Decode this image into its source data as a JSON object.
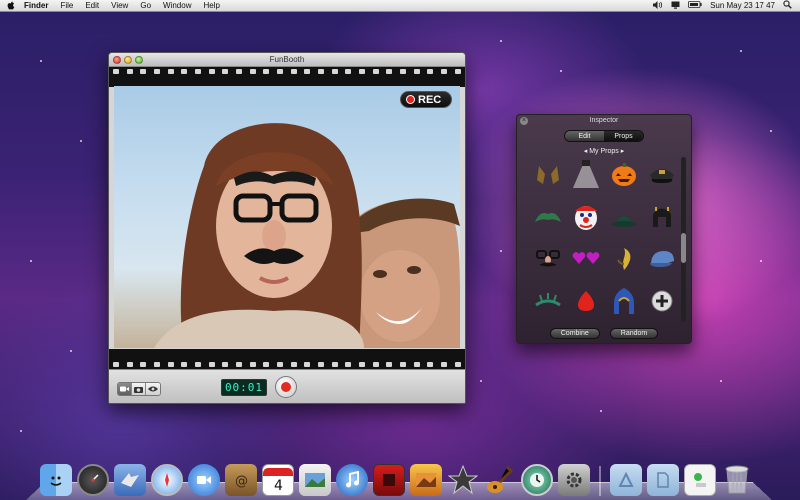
{
  "menubar": {
    "app": "Finder",
    "items": [
      "File",
      "Edit",
      "View",
      "Go",
      "Window",
      "Help"
    ],
    "clock": "Sun May 23  17 47"
  },
  "funbooth": {
    "title": "FunBooth",
    "rec_label": "REC",
    "counter": "00:01",
    "mode_buttons": [
      "video-mode-icon",
      "photo-mode-icon",
      "eye-icon"
    ]
  },
  "inspector": {
    "title": "Inspector",
    "tabs": [
      "Edit",
      "Props"
    ],
    "selected_tab": "Props",
    "section_label": "◂ My Props ▸",
    "props": [
      "cowbell-horns",
      "spotlight",
      "pumpkin-head",
      "police-cap",
      "green-hair",
      "clown-face",
      "green-witch-hat",
      "black-helmet",
      "glasses-mustache",
      "purple-hearts",
      "gold-horn",
      "blue-cap",
      "green-antenna",
      "red-nose",
      "blue-hood",
      "add-prop"
    ],
    "buttons": [
      "Combine",
      "Random"
    ]
  },
  "dock": {
    "items": [
      "finder-icon",
      "dashboard-icon",
      "mail-icon",
      "safari-icon",
      "ichat-icon",
      "address-book-icon",
      "ical-icon",
      "iphoto-icon",
      "itunes-icon",
      "photo-booth-icon",
      "iphoto-alt-icon",
      "imovie-icon",
      "garageband-icon",
      "time-machine-icon",
      "system-preferences-icon",
      "applications-folder-icon",
      "documents-folder-icon",
      "downloads-stack-icon",
      "trash-icon"
    ]
  }
}
